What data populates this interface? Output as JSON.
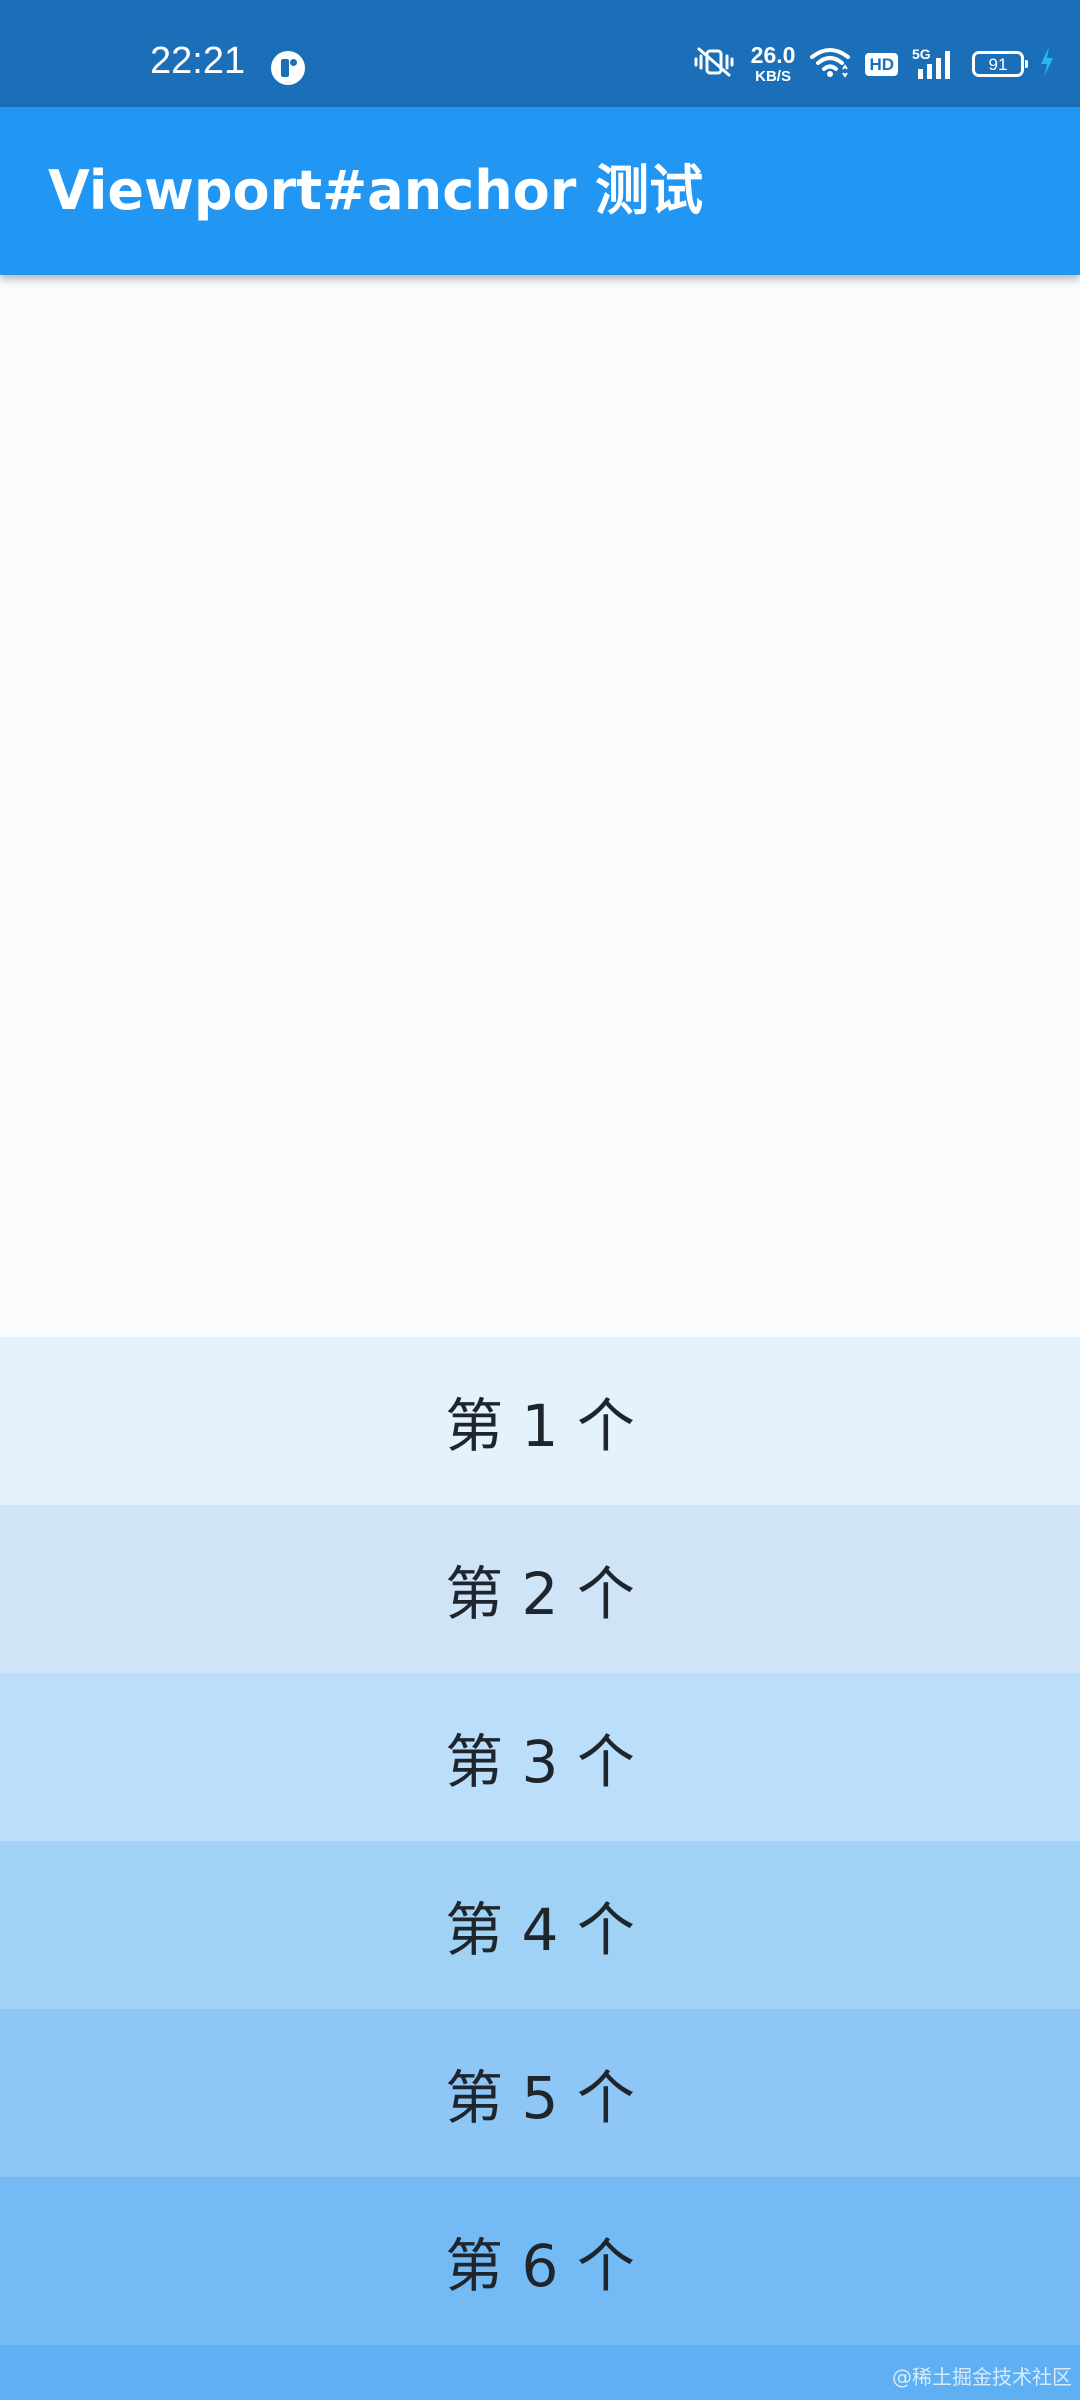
{
  "status_bar": {
    "time": "22:21",
    "net_speed_value": "26.0",
    "net_speed_unit": "KB/S",
    "hd_label": "HD",
    "network_type": "5G",
    "battery_level": "91",
    "icons": [
      "app-notification-icon",
      "vibrate-silent-icon",
      "wifi-icon",
      "hd-icon",
      "signal-icon",
      "battery-icon",
      "charging-icon"
    ],
    "background_color": "#1a6fb8"
  },
  "app_bar": {
    "title": "Viewport#anchor 测试",
    "background_color": "#2196f3"
  },
  "list": {
    "items": [
      {
        "label": "第 1 个",
        "color": "#e3f2fd"
      },
      {
        "label": "第 2 个",
        "color": "#cfe4f7"
      },
      {
        "label": "第 3 个",
        "color": "#bbdefb"
      },
      {
        "label": "第 4 个",
        "color": "#a0d2f6"
      },
      {
        "label": "第 5 个",
        "color": "#8ec7f6"
      },
      {
        "label": "第 6 个",
        "color": "#74bbf5"
      },
      {
        "label": "",
        "color": "#5fb0f3"
      }
    ]
  },
  "watermark": "@稀土掘金技术社区"
}
